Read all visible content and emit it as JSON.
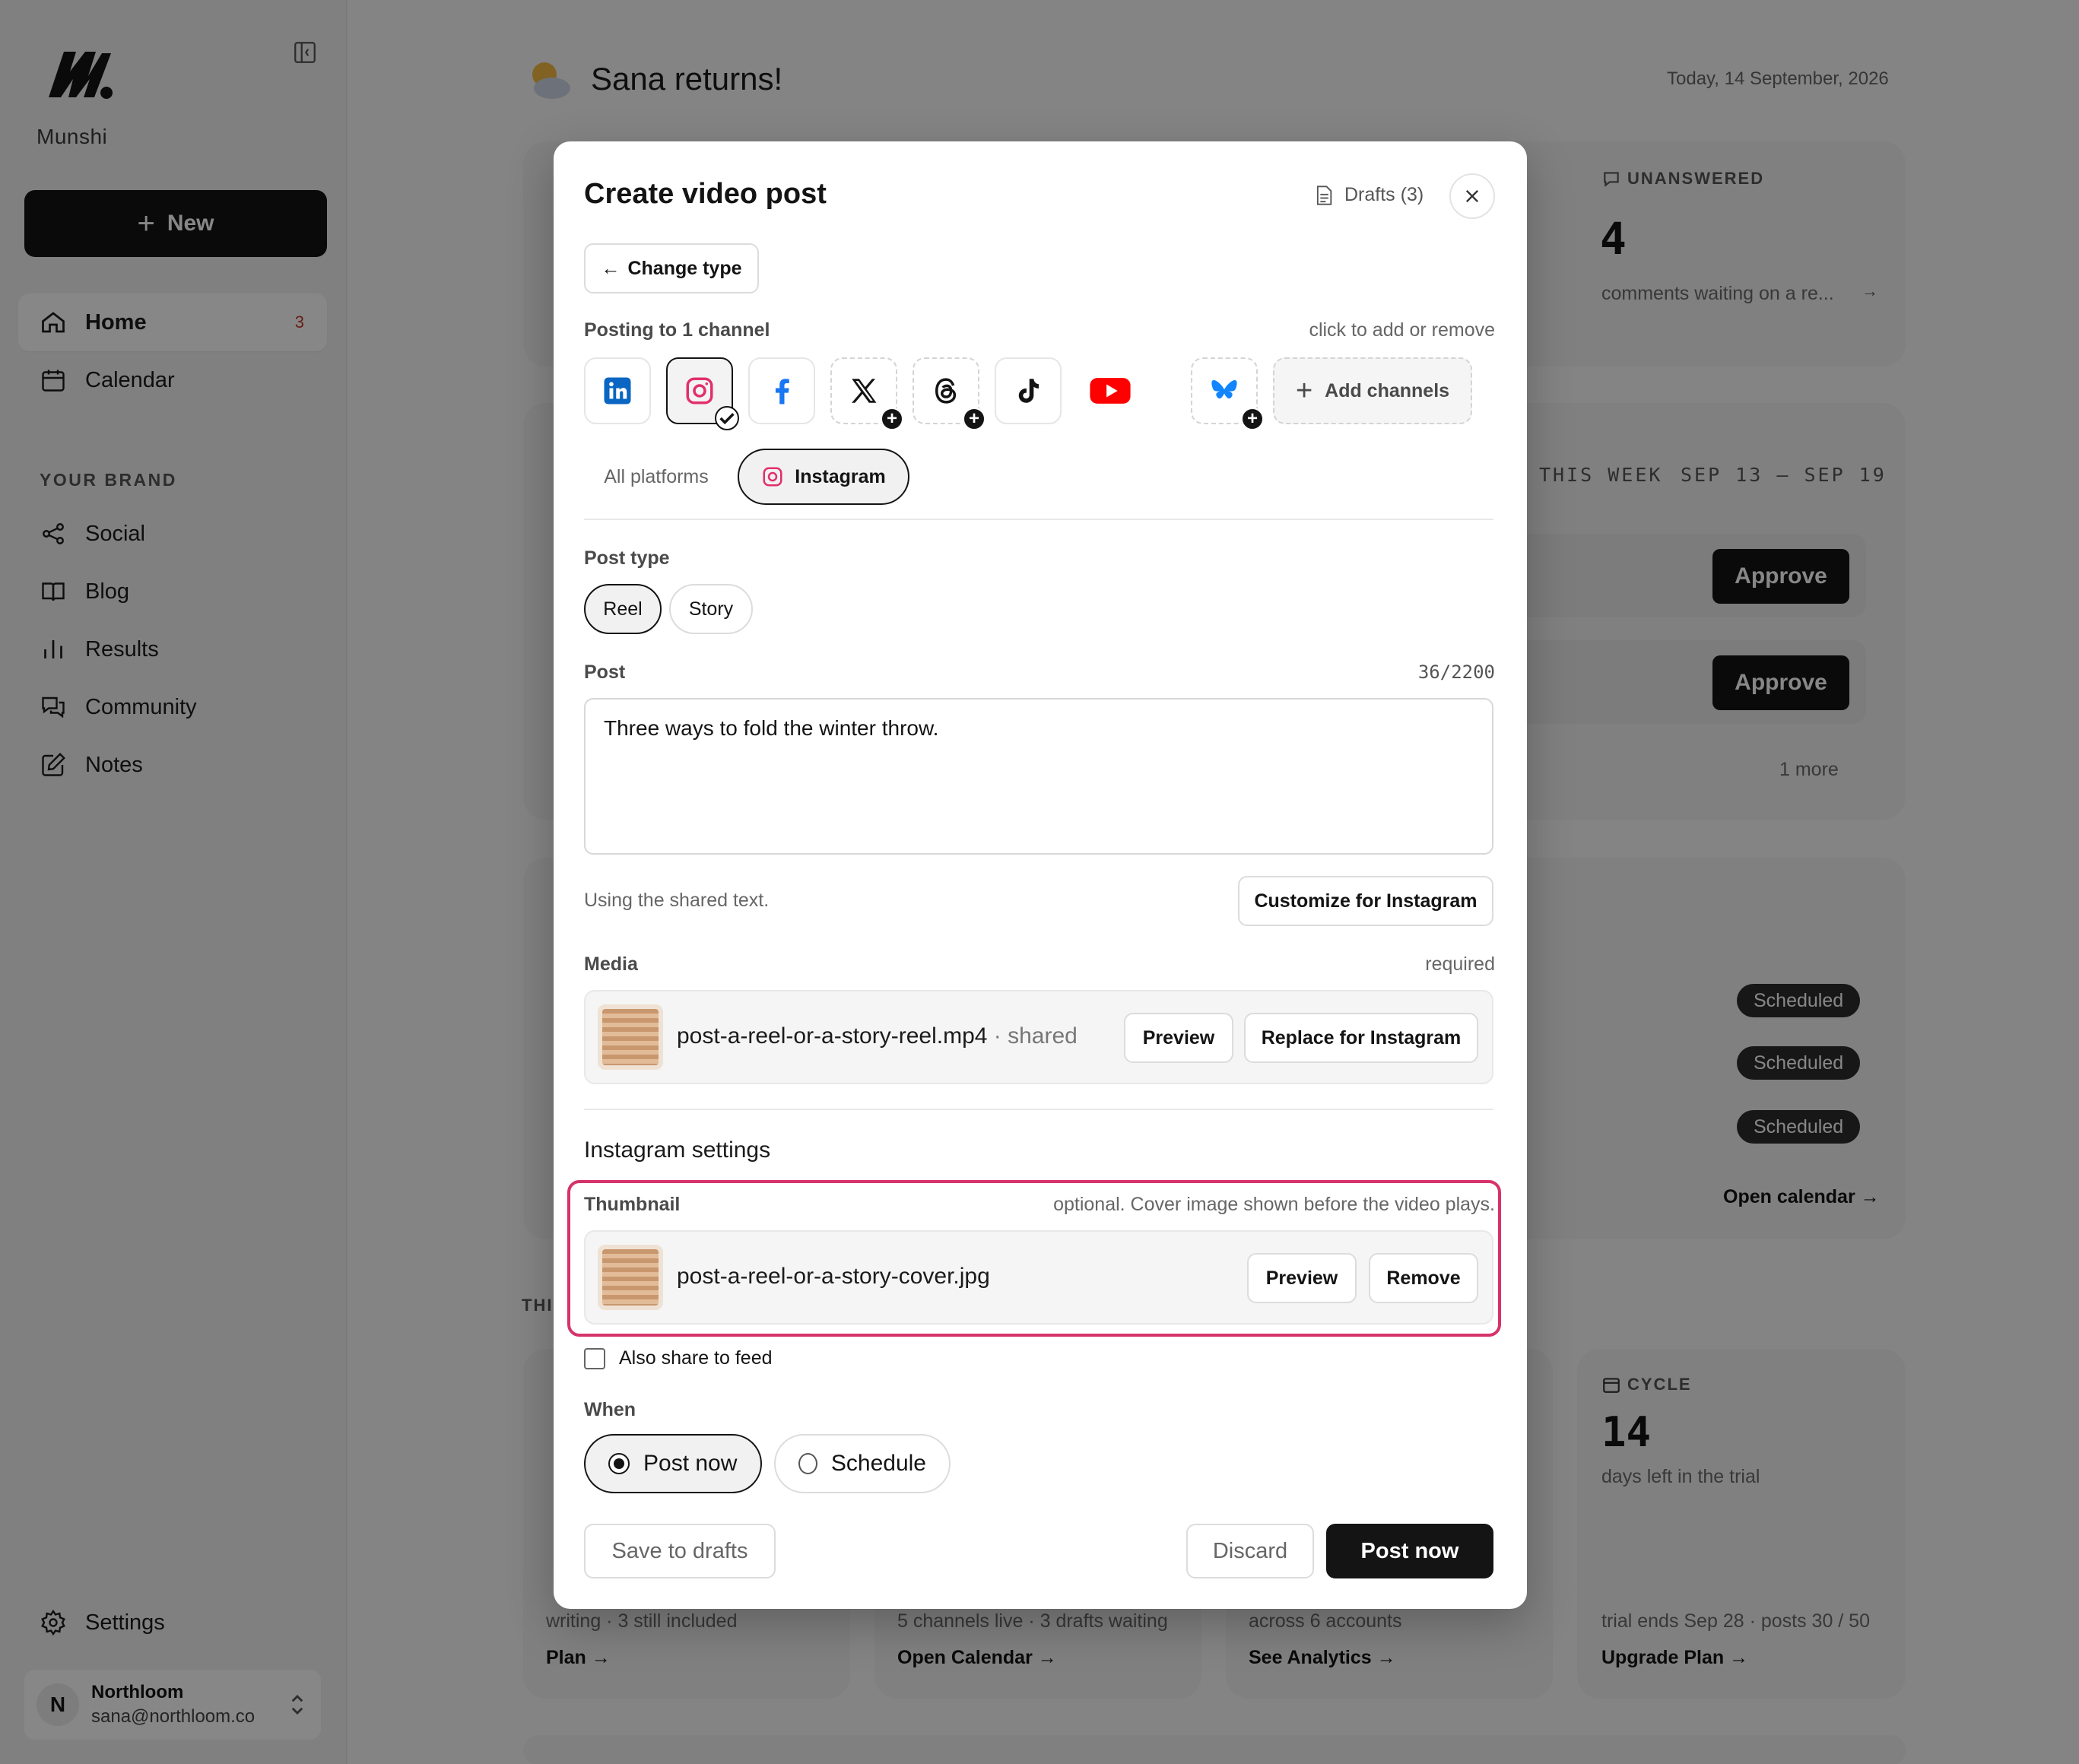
{
  "sidebar": {
    "brand": "Munshi",
    "new_label": "New",
    "nav": [
      {
        "label": "Home",
        "badge": "3"
      },
      {
        "label": "Calendar"
      }
    ],
    "section_label": "YOUR BRAND",
    "brand_nav": [
      {
        "label": "Social"
      },
      {
        "label": "Blog"
      },
      {
        "label": "Results"
      },
      {
        "label": "Community"
      },
      {
        "label": "Notes"
      }
    ],
    "settings_label": "Settings",
    "account": {
      "initial": "N",
      "name": "Northloom",
      "email": "sana@northloom.co"
    }
  },
  "dashboard": {
    "greeting": "Sana returns!",
    "date": "Today, 14 September, 2026",
    "unanswered": {
      "label": "UNANSWERED",
      "value": "4",
      "desc": "comments waiting on a re..."
    },
    "week": {
      "label": "THIS WEEK",
      "range": "SEP 13 – SEP 19",
      "approve_label": "Approve",
      "more": "1 more"
    },
    "scheduled_label": "Scheduled",
    "open_calendar_link": "Open calendar →",
    "section_fragment": "THI",
    "cycle": {
      "label": "CYCLE",
      "value": "14",
      "desc": "days left in the trial",
      "foot": "trial ends Sep 28 · posts 30 / 50",
      "link": "Upgrade Plan →"
    },
    "bottom_cards": [
      {
        "foot": "writing · 3 still included",
        "link": "Plan →"
      },
      {
        "foot": "5 channels live · 3 drafts waiting",
        "link": "Open Calendar →"
      },
      {
        "foot": "across 6 accounts",
        "link": "See Analytics →"
      }
    ]
  },
  "modal": {
    "title": "Create video post",
    "drafts_label": "Drafts (3)",
    "change_type_label": "Change type",
    "posting_to": "Posting to 1 channel",
    "posting_hint": "click to add or remove",
    "channels": [
      "linkedin",
      "instagram",
      "facebook",
      "x",
      "threads",
      "tiktok",
      "youtube",
      "bluesky"
    ],
    "add_channels_label": "Add channels",
    "tabs": {
      "all": "All platforms",
      "instagram": "Instagram"
    },
    "post_type_label": "Post type",
    "post_types": [
      "Reel",
      "Story"
    ],
    "post_label": "Post",
    "char_count": "36/2200",
    "post_text": "Three ways to fold the winter throw.",
    "shared_text_hint": "Using the shared text.",
    "customize_label": "Customize for Instagram",
    "media_label": "Media",
    "media_required": "required",
    "media_file": "post-a-reel-or-a-story-reel.mp4",
    "media_shared": "· shared",
    "preview_label": "Preview",
    "replace_label": "Replace for Instagram",
    "ig_settings_label": "Instagram settings",
    "thumbnail_label": "Thumbnail",
    "thumbnail_hint": "optional. Cover image shown before the video plays.",
    "thumbnail_file": "post-a-reel-or-a-story-cover.jpg",
    "remove_label": "Remove",
    "share_feed_label": "Also share to feed",
    "when_label": "When",
    "when_options": [
      "Post now",
      "Schedule"
    ],
    "save_drafts_label": "Save to drafts",
    "discard_label": "Discard",
    "post_now_label": "Post now",
    "colors": {
      "accent": "#141414",
      "highlight": "#d6336c",
      "instagram": "#e1306c",
      "linkedin": "#0a66c2",
      "facebook": "#1877f2",
      "youtube": "#ff0000",
      "bluesky": "#1185fe"
    }
  }
}
